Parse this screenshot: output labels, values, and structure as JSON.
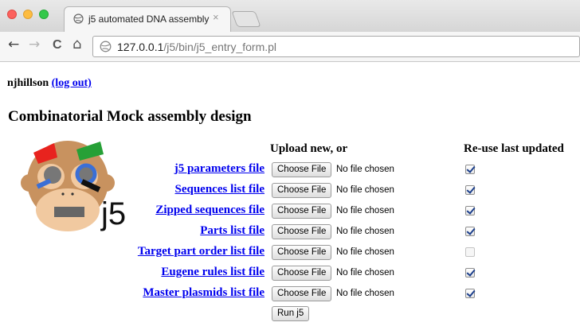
{
  "browser": {
    "tab_title": "j5 automated DNA assembly",
    "tab_close": "×",
    "url_host": "127.0.0.1",
    "url_path": "/j5/bin/j5_entry_form.pl",
    "nav": {
      "back": "←",
      "forward": "→",
      "reload": "C",
      "home": "⌂"
    },
    "traffic_lights": [
      "#fc615d",
      "#fdbc40",
      "#34c84a"
    ]
  },
  "page": {
    "username": "njhillson",
    "logout_label": "(log out)",
    "title": "Combinatorial Mock assembly design",
    "col_upload": "Upload new, or",
    "col_reuse": "Re-use last updated",
    "choose_label": "Choose File",
    "no_file_text": "No file chosen",
    "rows": [
      {
        "label": "j5 parameters file",
        "reuse": true
      },
      {
        "label": "Sequences list file",
        "reuse": true
      },
      {
        "label": "Zipped sequences file",
        "reuse": true
      },
      {
        "label": "Parts list file",
        "reuse": true
      },
      {
        "label": "Target part order list file",
        "reuse": false
      },
      {
        "label": "Eugene rules list file",
        "reuse": true
      },
      {
        "label": "Master plasmids list file",
        "reuse": true
      }
    ],
    "run_label": "Run j5",
    "logo_text": "j5"
  },
  "colors": {
    "link": "#0000ee",
    "checkbox_check": "#1c3f8c"
  }
}
